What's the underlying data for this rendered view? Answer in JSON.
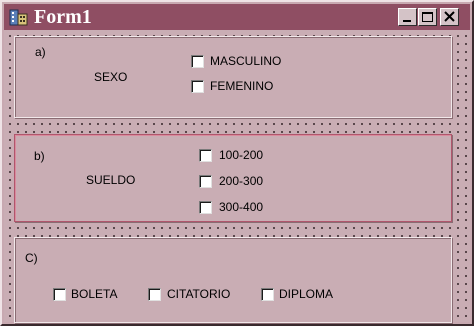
{
  "window": {
    "title": "Form1",
    "controls": {
      "minimize": "minimize-icon",
      "maximize": "maximize-icon",
      "close": "close-icon"
    }
  },
  "frame_a": {
    "letter": "a)",
    "label": "SEXO",
    "options": [
      "MASCULINO",
      "FEMENINO"
    ]
  },
  "frame_b": {
    "letter": "b)",
    "label": "SUELDO",
    "options": [
      "100-200",
      "200-300",
      "300-400"
    ]
  },
  "frame_c": {
    "letter": "C)",
    "options": [
      "BOLETA",
      "CITATORIO",
      "DIPLOMA"
    ]
  },
  "colors": {
    "titlebar": "#8f4e63",
    "form_background": "#c9adb4",
    "selected_frame_border": "#b0566c"
  }
}
